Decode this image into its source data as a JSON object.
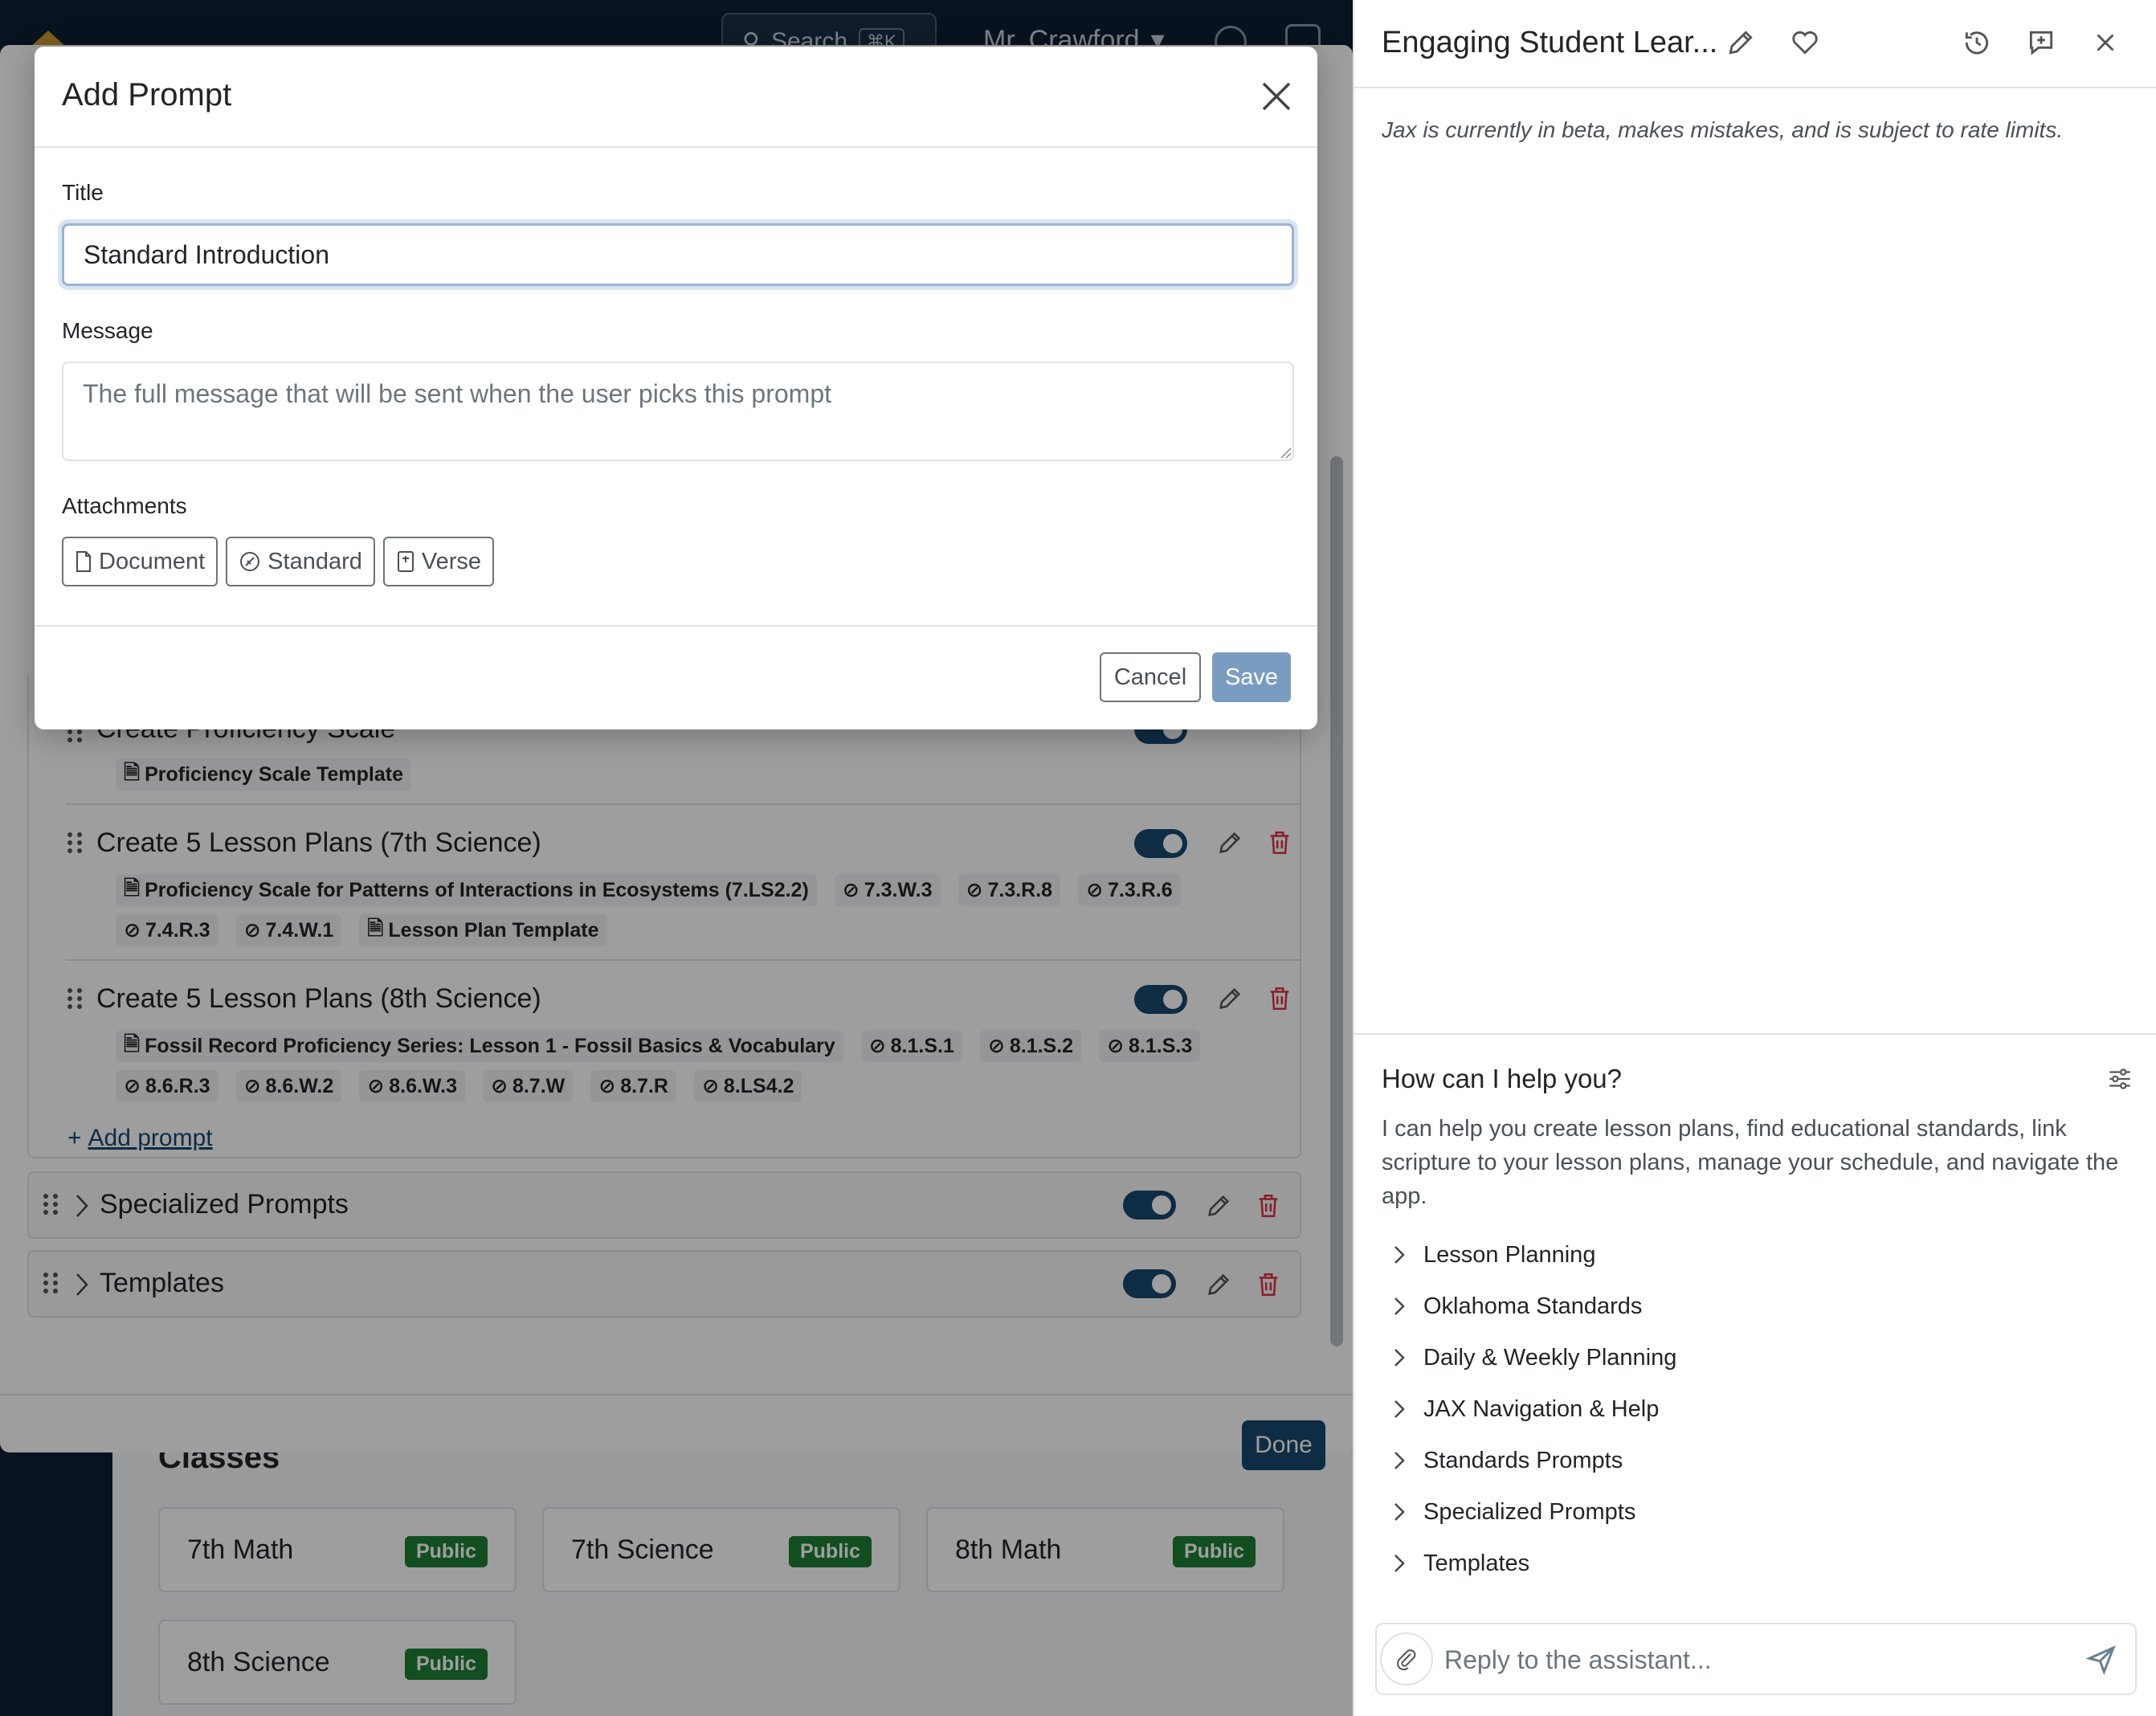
{
  "topbar": {
    "search_label": "Search",
    "search_kbd": "⌘K",
    "user_name": "Mr. Crawford"
  },
  "classes": {
    "title": "Classes",
    "items": [
      {
        "name": "7th Math",
        "badge": "Public"
      },
      {
        "name": "7th Science",
        "badge": "Public"
      },
      {
        "name": "8th Math",
        "badge": "Public"
      },
      {
        "name": "8th Science",
        "badge": "Public"
      }
    ]
  },
  "manager": {
    "prompts": [
      {
        "title": "Create Proficiency Scale",
        "tags": [
          {
            "icon": "document-icon",
            "label": "Proficiency Scale Template"
          }
        ]
      },
      {
        "title": "Create 5 Lesson Plans (7th Science)",
        "tags": [
          {
            "icon": "document-icon",
            "label": "Proficiency Scale for Patterns of Interactions in Ecosystems (7.LS2.2)"
          },
          {
            "icon": "standard-icon",
            "label": "7.3.W.3"
          },
          {
            "icon": "standard-icon",
            "label": "7.3.R.8"
          },
          {
            "icon": "standard-icon",
            "label": "7.3.R.6"
          },
          {
            "icon": "standard-icon",
            "label": "7.4.R.3"
          },
          {
            "icon": "standard-icon",
            "label": "7.4.W.1"
          },
          {
            "icon": "document-icon",
            "label": "Lesson Plan Template"
          }
        ]
      },
      {
        "title": "Create 5 Lesson Plans (8th Science)",
        "tags": [
          {
            "icon": "document-icon",
            "label": "Fossil Record Proficiency Series: Lesson 1 - Fossil Basics & Vocabulary"
          },
          {
            "icon": "standard-icon",
            "label": "8.1.S.1"
          },
          {
            "icon": "standard-icon",
            "label": "8.1.S.2"
          },
          {
            "icon": "standard-icon",
            "label": "8.1.S.3"
          },
          {
            "icon": "standard-icon",
            "label": "8.6.R.3"
          },
          {
            "icon": "standard-icon",
            "label": "8.6.W.2"
          },
          {
            "icon": "standard-icon",
            "label": "8.6.W.3"
          },
          {
            "icon": "standard-icon",
            "label": "8.7.W"
          },
          {
            "icon": "standard-icon",
            "label": "8.7.R"
          },
          {
            "icon": "standard-icon",
            "label": "8.LS4.2"
          }
        ]
      }
    ],
    "add_prompt_label": "Add prompt",
    "groups": [
      {
        "title": "Specialized Prompts"
      },
      {
        "title": "Templates"
      }
    ],
    "done_label": "Done"
  },
  "dialog": {
    "title": "Add Prompt",
    "title_label": "Title",
    "title_value": "Standard Introduction",
    "message_label": "Message",
    "message_placeholder": "The full message that will be sent when the user picks this prompt",
    "attachments_label": "Attachments",
    "attachments": [
      {
        "icon": "document-icon",
        "label": "Document"
      },
      {
        "icon": "standard-icon",
        "label": "Standard"
      },
      {
        "icon": "verse-icon",
        "label": "Verse"
      }
    ],
    "cancel_label": "Cancel",
    "save_label": "Save"
  },
  "chat": {
    "title": "Engaging Student Lear...",
    "beta_notice": "Jax is currently in beta, makes mistakes, and is subject to rate limits.",
    "help_title": "How can I help you?",
    "help_description": "I can help you create lesson plans, find educational standards, link scripture to your lesson plans, manage your schedule, and navigate the app.",
    "categories": [
      "Lesson Planning",
      "Oklahoma Standards",
      "Daily & Weekly Planning",
      "JAX Navigation & Help",
      "Standards Prompts",
      "Specialized Prompts",
      "Templates"
    ],
    "reply_placeholder": "Reply to the assistant..."
  },
  "colors": {
    "primary": "#17486e",
    "badge": "#1e7e34",
    "danger": "#dc3545",
    "save_disabled": "#7a9cc0"
  }
}
